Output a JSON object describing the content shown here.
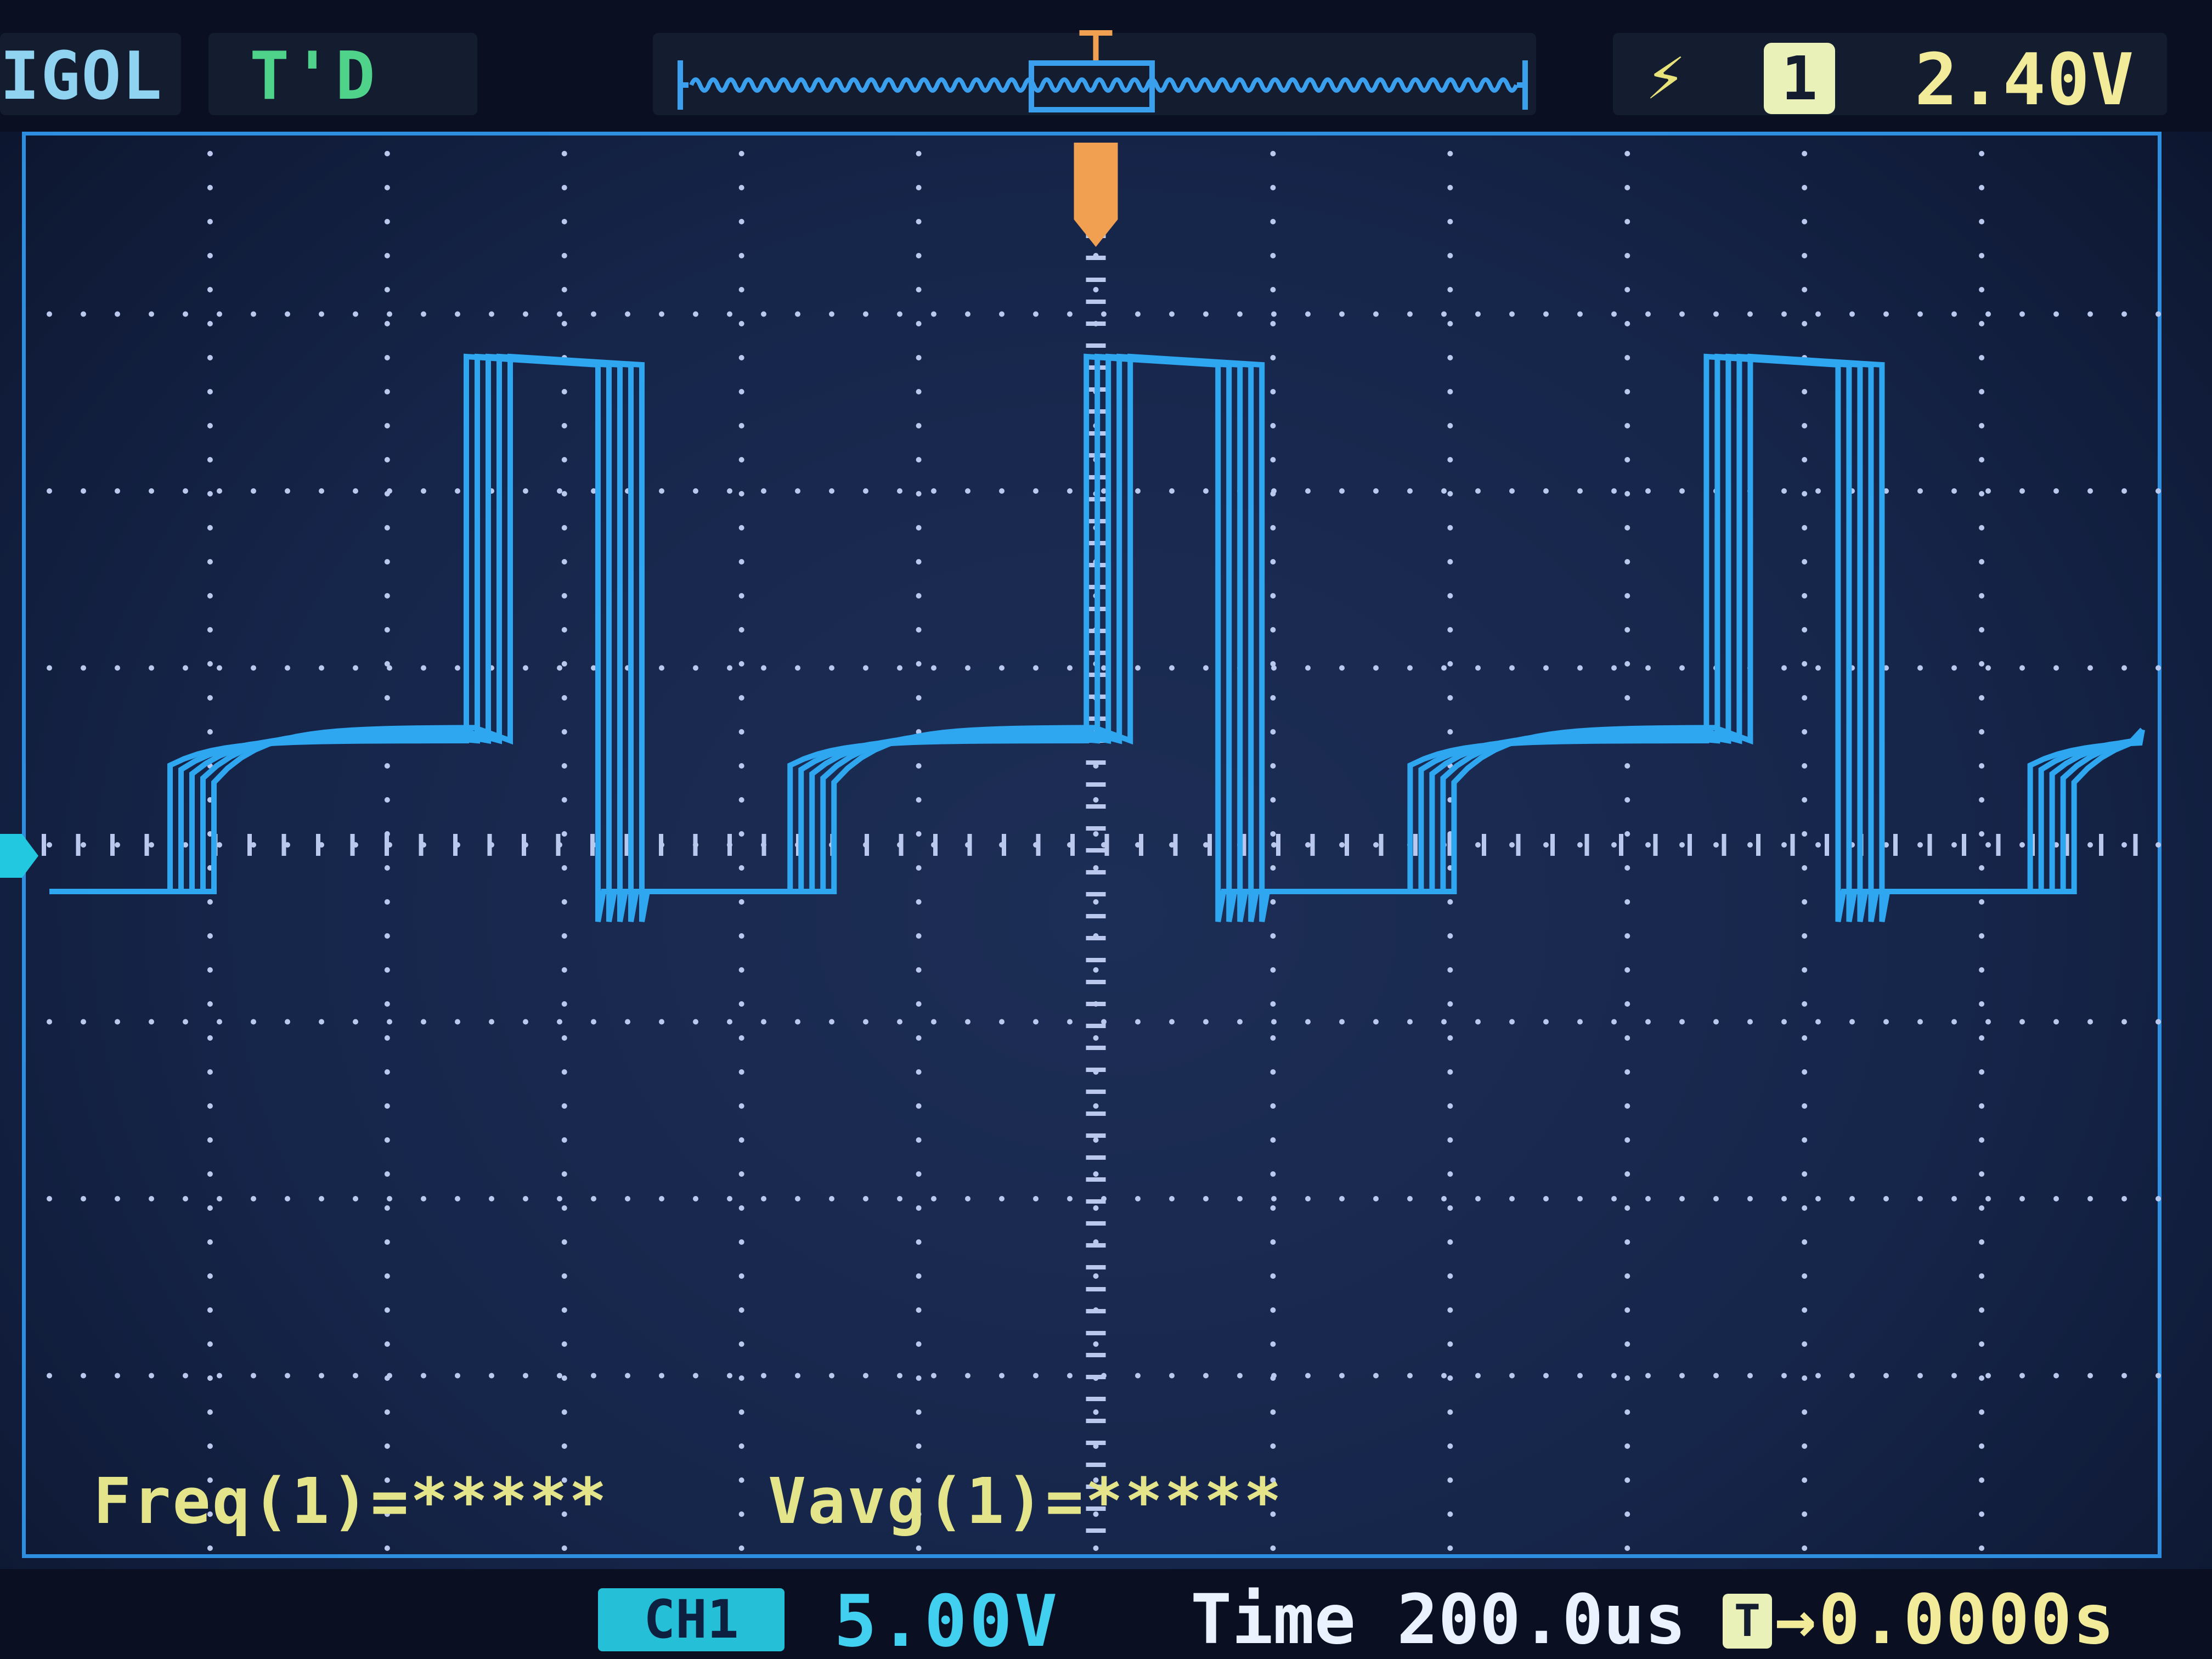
{
  "header": {
    "brand": "IGOL",
    "acquisition_status": "T'D",
    "trigger_edge_icon": "rising-edge-icon",
    "trigger_source": "1",
    "trigger_level": "2.40V"
  },
  "measurements": {
    "freq": "Freq(1)=*****",
    "vavg": "Vavg(1)=*****"
  },
  "footer": {
    "ch1_badge": "CH1",
    "ch1_scale": "5.00V",
    "timebase": "Time 200.0us",
    "trigger_offset_icon": "T",
    "trigger_offset_arrow": "→",
    "trigger_offset": "0.0000s"
  },
  "colors": {
    "trace": "#2fa7f0",
    "grid": "#b9c8ec",
    "frame": "#2e8fe0",
    "trigger_marker": "#f0a050",
    "ground_marker": "#22c8e0"
  },
  "waveform": {
    "grid_divisions_horizontal": 12,
    "grid_divisions_vertical": 8,
    "signal_type": "square wave with exponential rising steps",
    "period_divisions": 3.5
  }
}
